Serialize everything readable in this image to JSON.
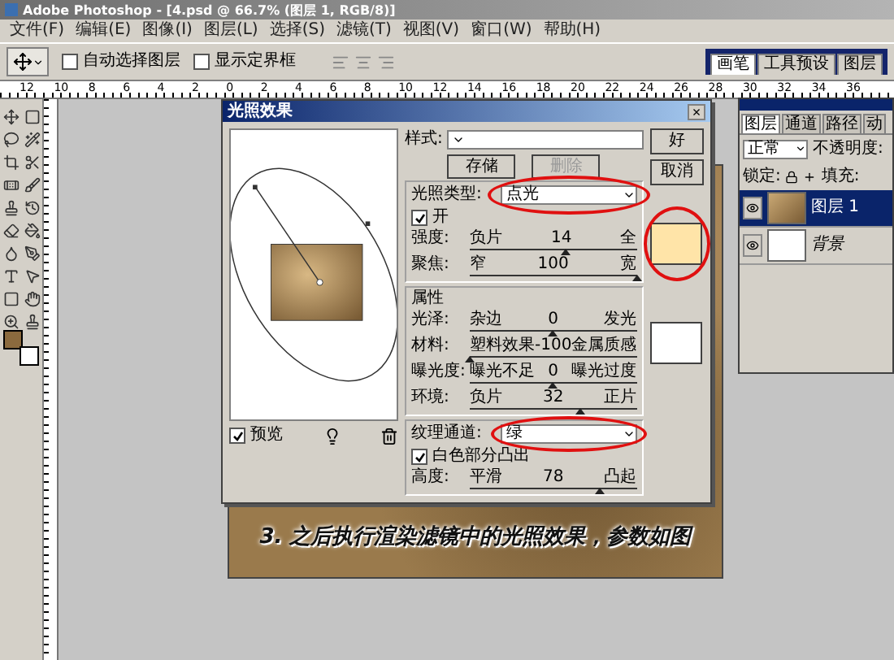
{
  "window": {
    "title": "Adobe Photoshop - [4.psd @ 66.7% (图层 1, RGB/8)]"
  },
  "menu": [
    "文件(F)",
    "编辑(E)",
    "图像(I)",
    "图层(L)",
    "选择(S)",
    "滤镜(T)",
    "视图(V)",
    "窗口(W)",
    "帮助(H)"
  ],
  "options_bar": {
    "checkboxes": [
      {
        "label": "自动选择图层",
        "checked": false
      },
      {
        "label": "显示定界框",
        "checked": false
      }
    ],
    "palette_tabs": [
      {
        "label": "画笔",
        "selected": true
      },
      {
        "label": "工具预设",
        "selected": false
      },
      {
        "label": "图层",
        "selected": false
      }
    ]
  },
  "ruler": [
    "12",
    "10",
    "8",
    "6",
    "4",
    "2",
    "0",
    "2",
    "4",
    "6",
    "8",
    "10",
    "12",
    "14",
    "16",
    "18",
    "20",
    "22",
    "24",
    "26",
    "28",
    "30",
    "32",
    "34",
    "36"
  ],
  "dialog": {
    "title": "光照效果",
    "close": "×",
    "preview": {
      "label": "预览",
      "checked": true
    },
    "style": {
      "label": "样式:"
    },
    "buttons": [
      {
        "label": "存储",
        "disabled": false
      },
      {
        "label": "删除",
        "disabled": true
      }
    ],
    "actions": [
      "好",
      "取消"
    ],
    "light": {
      "label": "光照类型:",
      "value": "点光",
      "color": "#ffe4a8",
      "on": {
        "label": "开",
        "checked": true
      },
      "sliders": [
        {
          "label": "强度:",
          "left": "负片",
          "reading": "14",
          "right": "全",
          "level": 0.57
        },
        {
          "label": "聚焦:",
          "left": "窄",
          "reading": "100",
          "right": "宽",
          "level": 1
        }
      ]
    },
    "properties": {
      "title": "属性",
      "color": "#ffffff",
      "sliders": [
        {
          "label": "光泽:",
          "left": "杂边",
          "reading": "0",
          "right": "发光",
          "level": 0.5
        },
        {
          "label": "材料:",
          "left": "塑料效果",
          "reading": "-100",
          "right": "金属质感",
          "level": 0
        },
        {
          "label": "曝光度:",
          "left": "曝光不足",
          "reading": "0",
          "right": "曝光过度",
          "level": 0.5
        },
        {
          "label": "环境:",
          "left": "负片",
          "reading": "32",
          "right": "正片",
          "level": 0.66
        }
      ]
    },
    "texture": {
      "label": "纹理通道:",
      "value": "绿",
      "raised": {
        "label": "白色部分凸出",
        "checked": true
      },
      "slider": {
        "label": "高度:",
        "left": "平滑",
        "reading": "78",
        "right": "凸起",
        "level": 0.78
      }
    }
  },
  "layers_panel": {
    "tabs": [
      {
        "label": "图层",
        "selected": true
      },
      {
        "label": "通道",
        "selected": false
      },
      {
        "label": "路径",
        "selected": false
      },
      {
        "label": "动",
        "selected": false
      }
    ],
    "blend_mode": "正常",
    "opacity_label": "不透明度:",
    "lock_label": "锁定:",
    "fill_label": "填充:",
    "layers": [
      {
        "name": "图层 1",
        "kind": "layer",
        "selected": true,
        "visible": true
      },
      {
        "name": "背景",
        "kind": "background",
        "selected": false,
        "visible": true
      }
    ]
  },
  "caption": "3. 之后执行渲染滤镜中的光照效果，参数如图"
}
